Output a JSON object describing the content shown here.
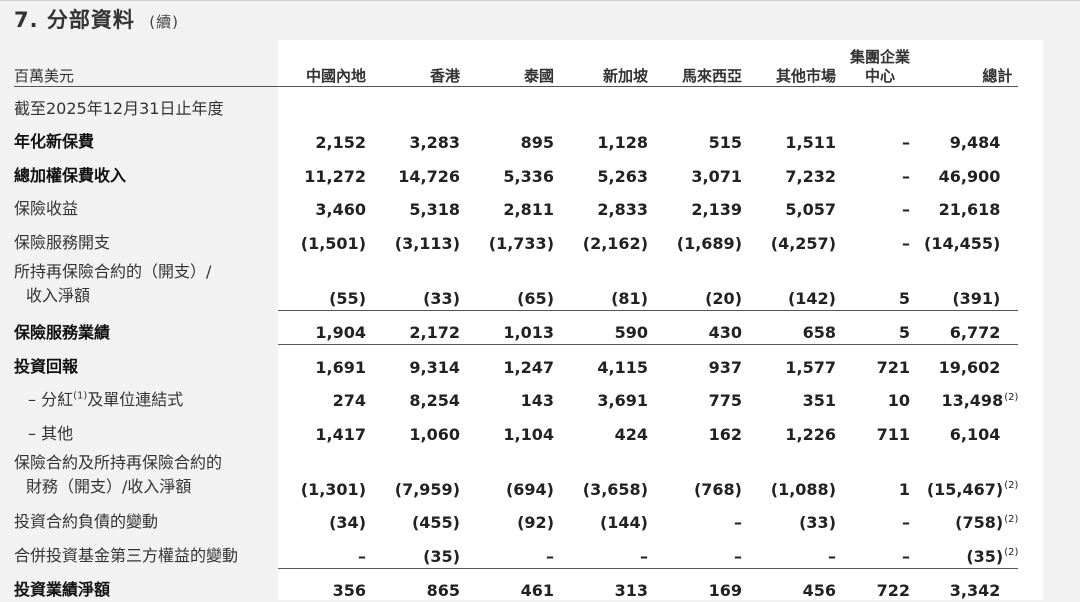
{
  "section": {
    "number": "7.",
    "title": "分部資料",
    "continued": "(續)"
  },
  "headers": {
    "unit": "百萬美元",
    "columns": [
      "中國內地",
      "香港",
      "泰國",
      "新加坡",
      "馬來西亞",
      "其他市場",
      "集團企業\n中心",
      "總計"
    ]
  },
  "period_label": "截至2025年12月31日止年度",
  "rows": [
    {
      "label": "年化新保費",
      "bold": true,
      "values": [
        "2,152",
        "3,283",
        "895",
        "1,128",
        "515",
        "1,511",
        "–",
        "9,484"
      ],
      "note": ""
    },
    {
      "label": "總加權保費收入",
      "bold": true,
      "values": [
        "11,272",
        "14,726",
        "5,336",
        "5,263",
        "3,071",
        "7,232",
        "–",
        "46,900"
      ],
      "note": ""
    },
    {
      "label": "保險收益",
      "bold": false,
      "values": [
        "3,460",
        "5,318",
        "2,811",
        "2,833",
        "2,139",
        "5,057",
        "–",
        "21,618"
      ],
      "note": ""
    },
    {
      "label": "保險服務開支",
      "bold": false,
      "values": [
        "(1,501)",
        "(3,113)",
        "(1,733)",
        "(2,162)",
        "(1,689)",
        "(4,257)",
        "–",
        "(14,455)"
      ],
      "note": ""
    },
    {
      "label_line1": "所持再保險合約的（開支）/",
      "label_line2": "收入淨額",
      "bold": false,
      "values": [
        "(55)",
        "(33)",
        "(65)",
        "(81)",
        "(20)",
        "(142)",
        "5",
        "(391)"
      ],
      "note": ""
    },
    {
      "label": "保險服務業績",
      "bold": true,
      "values": [
        "1,904",
        "2,172",
        "1,013",
        "590",
        "430",
        "658",
        "5",
        "6,772"
      ],
      "note": ""
    },
    {
      "label": "投資回報",
      "bold": true,
      "values": [
        "1,691",
        "9,314",
        "1,247",
        "4,115",
        "937",
        "1,577",
        "721",
        "19,602"
      ],
      "note": ""
    },
    {
      "label_prefix": "– 分紅",
      "label_note": "(1)",
      "label_suffix": "及單位連結式",
      "bold": false,
      "values": [
        "274",
        "8,254",
        "143",
        "3,691",
        "775",
        "351",
        "10",
        "13,498"
      ],
      "note": "(2)"
    },
    {
      "label": "– 其他",
      "bold": false,
      "values": [
        "1,417",
        "1,060",
        "1,104",
        "424",
        "162",
        "1,226",
        "711",
        "6,104"
      ],
      "note": ""
    },
    {
      "label_line1": "保險合約及所持再保險合約的",
      "label_line2": "財務（開支）/收入淨額",
      "bold": false,
      "values": [
        "(1,301)",
        "(7,959)",
        "(694)",
        "(3,658)",
        "(768)",
        "(1,088)",
        "1",
        "(15,467)"
      ],
      "note": "(2)"
    },
    {
      "label": "投資合約負債的變動",
      "bold": false,
      "values": [
        "(34)",
        "(455)",
        "(92)",
        "(144)",
        "–",
        "(33)",
        "–",
        "(758)"
      ],
      "note": "(2)"
    },
    {
      "label": "合併投資基金第三方權益的變動",
      "bold": false,
      "values": [
        "–",
        "(35)",
        "–",
        "–",
        "–",
        "–",
        "–",
        "(35)"
      ],
      "note": "(2)"
    },
    {
      "label": "投資業績淨額",
      "bold": true,
      "values": [
        "356",
        "865",
        "461",
        "313",
        "169",
        "456",
        "722",
        "3,342"
      ],
      "note": ""
    }
  ]
}
